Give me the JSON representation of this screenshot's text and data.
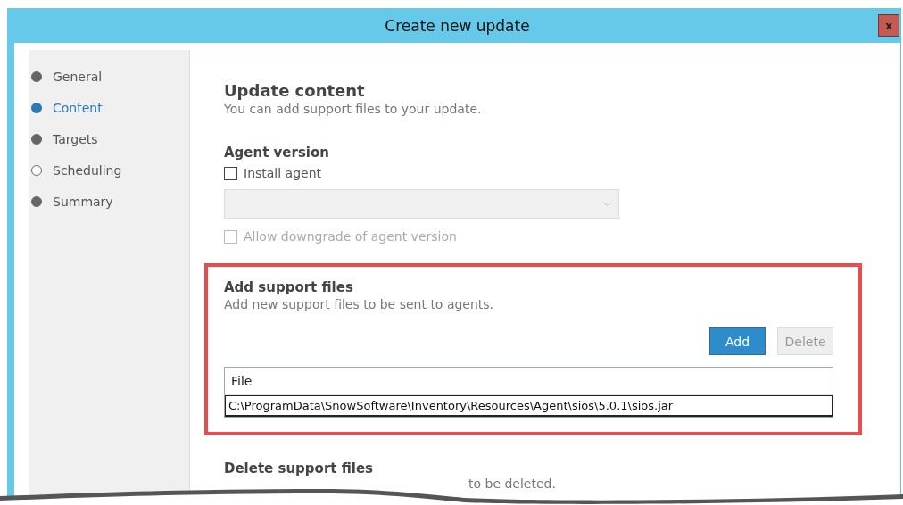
{
  "window": {
    "title": "Create new update",
    "close": "x"
  },
  "steps": [
    {
      "label": "General",
      "selected": false,
      "completed": true
    },
    {
      "label": "Content",
      "selected": true,
      "completed": true
    },
    {
      "label": "Targets",
      "selected": false,
      "completed": true
    },
    {
      "label": "Scheduling",
      "selected": false,
      "completed": false
    },
    {
      "label": "Summary",
      "selected": false,
      "completed": true
    }
  ],
  "page": {
    "title": "Update content",
    "subtitle": "You can add support files to your update."
  },
  "agent_version": {
    "heading": "Agent version",
    "install": {
      "label": "Install agent",
      "checked": false,
      "disabled": false
    },
    "version_select": {
      "disabled": true
    },
    "downgrade": {
      "label": "Allow downgrade of agent version",
      "checked": false,
      "disabled": true
    }
  },
  "add_files": {
    "heading": "Add support files",
    "subtitle": "Add new support files to be sent to agents.",
    "highlighted": true,
    "buttons": [
      {
        "label": "Add",
        "disabled": false
      },
      {
        "label": "Delete",
        "disabled": true
      }
    ],
    "table": {
      "columns": [
        "File"
      ],
      "rows": [
        {
          "cells": [
            "C:\\ProgramData\\SnowSoftware\\Inventory\\Resources\\Agent\\sios\\5.0.1\\sios.jar"
          ],
          "selected": true
        }
      ]
    }
  },
  "delete_files": {
    "heading": "Delete support files",
    "subtitle_fragment": "to be deleted."
  }
}
